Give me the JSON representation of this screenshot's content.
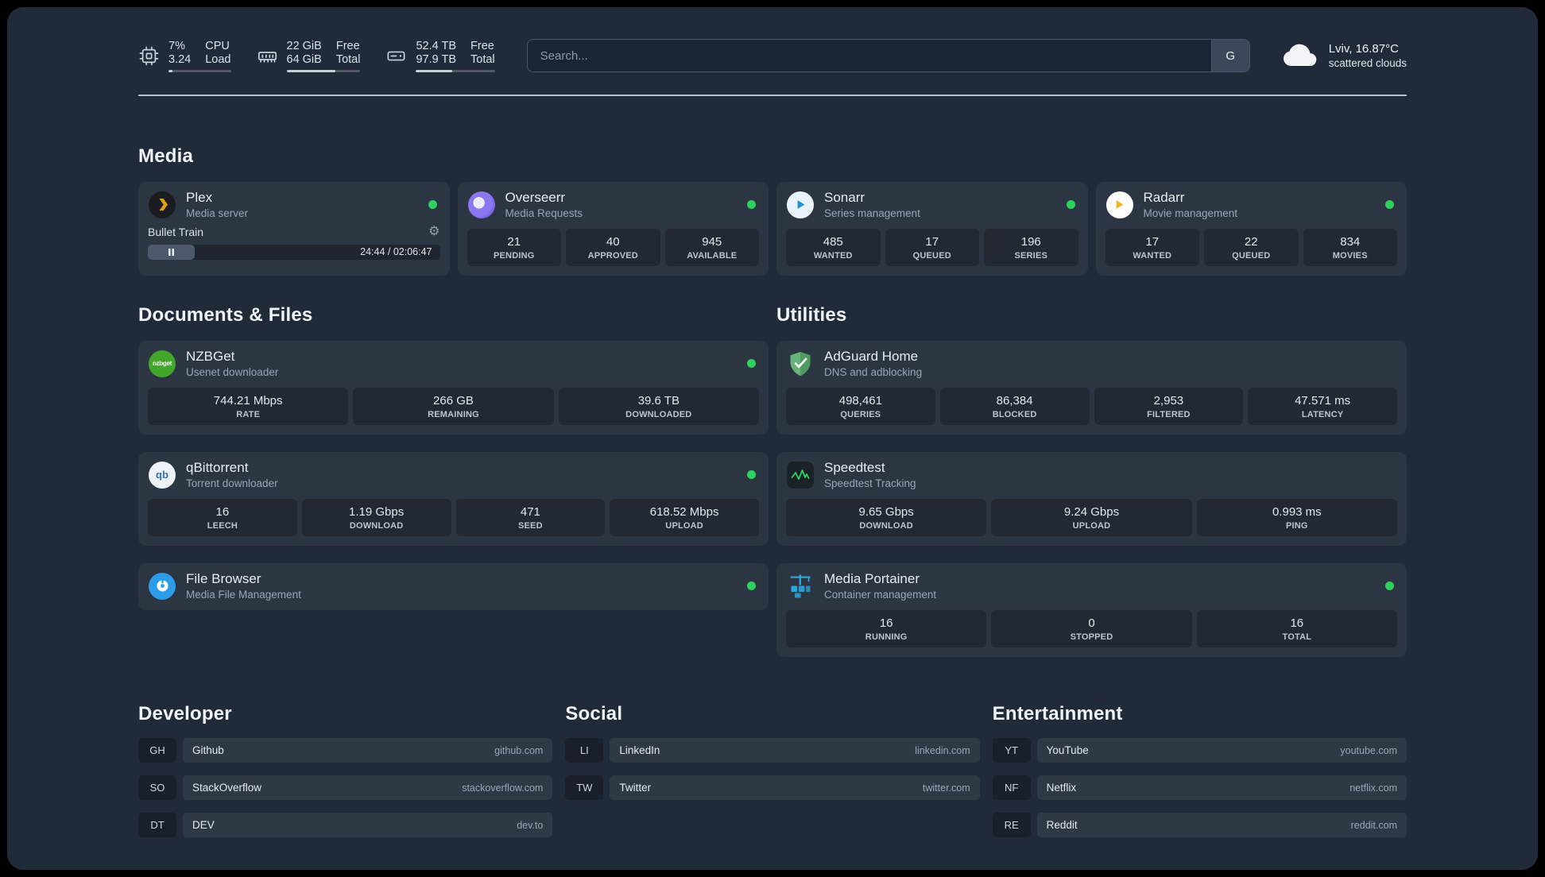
{
  "colors": {
    "status_green": "#2fd05e"
  },
  "topbar": {
    "resources": [
      {
        "id": "cpu",
        "icon": "cpu-icon",
        "values": [
          "7%",
          "3.24"
        ],
        "labels": [
          "CPU",
          "Load"
        ],
        "progress": 7
      },
      {
        "id": "memory",
        "icon": "memory-icon",
        "values": [
          "22 GiB",
          "64 GiB"
        ],
        "labels": [
          "Free",
          "Total"
        ],
        "progress": 66
      },
      {
        "id": "disk",
        "icon": "disk-icon",
        "values": [
          "52.4 TB",
          "97.9 TB"
        ],
        "labels": [
          "Free",
          "Total"
        ],
        "progress": 46
      }
    ],
    "search": {
      "placeholder": "Search...",
      "button": "G"
    },
    "weather": {
      "icon": "cloud-icon",
      "location": "Lviv, 16.87°C",
      "condition": "scattered clouds"
    }
  },
  "service_groups": [
    {
      "title": "Media",
      "slot": "media",
      "cards": [
        {
          "id": "plex",
          "name": "Plex",
          "description": "Media server",
          "icon": "plex-icon",
          "status": true,
          "media_widget": {
            "title": "Bullet Train",
            "time": "24:44 / 02:06:47",
            "progress": 16
          }
        },
        {
          "id": "overseerr",
          "name": "Overseerr",
          "description": "Media Requests",
          "icon": "overseerr-icon",
          "status": true,
          "stats": [
            {
              "value": "21",
              "label": "PENDING"
            },
            {
              "value": "40",
              "label": "APPROVED"
            },
            {
              "value": "945",
              "label": "AVAILABLE"
            }
          ]
        },
        {
          "id": "sonarr",
          "name": "Sonarr",
          "description": "Series management",
          "icon": "sonarr-icon",
          "status": true,
          "stats": [
            {
              "value": "485",
              "label": "WANTED"
            },
            {
              "value": "17",
              "label": "QUEUED"
            },
            {
              "value": "196",
              "label": "SERIES"
            }
          ]
        },
        {
          "id": "radarr",
          "name": "Radarr",
          "description": "Movie management",
          "icon": "radarr-icon",
          "status": true,
          "stats": [
            {
              "value": "17",
              "label": "WANTED"
            },
            {
              "value": "22",
              "label": "QUEUED"
            },
            {
              "value": "834",
              "label": "MOVIES"
            }
          ]
        }
      ]
    },
    {
      "title": "Documents & Files",
      "slot": "left",
      "cards": [
        {
          "id": "nzbget",
          "name": "NZBGet",
          "description": "Usenet downloader",
          "icon": "nzbget-icon",
          "status": true,
          "stats": [
            {
              "value": "744.21 Mbps",
              "label": "RATE"
            },
            {
              "value": "266 GB",
              "label": "REMAINING"
            },
            {
              "value": "39.6 TB",
              "label": "DOWNLOADED"
            }
          ]
        },
        {
          "id": "qbittorrent",
          "name": "qBittorrent",
          "description": "Torrent downloader",
          "icon": "qbittorrent-icon",
          "status": true,
          "stats": [
            {
              "value": "16",
              "label": "LEECH"
            },
            {
              "value": "1.19 Gbps",
              "label": "DOWNLOAD"
            },
            {
              "value": "471",
              "label": "SEED"
            },
            {
              "value": "618.52 Mbps",
              "label": "UPLOAD"
            }
          ]
        },
        {
          "id": "filebrowser",
          "name": "File Browser",
          "description": "Media File Management",
          "icon": "filebrowser-icon",
          "status": true,
          "stats": []
        }
      ]
    },
    {
      "title": "Utilities",
      "slot": "right",
      "cards": [
        {
          "id": "adguard",
          "name": "AdGuard Home",
          "description": "DNS and adblocking",
          "icon": "adguard-icon",
          "status": false,
          "stats": [
            {
              "value": "498,461",
              "label": "QUERIES"
            },
            {
              "value": "86,384",
              "label": "BLOCKED"
            },
            {
              "value": "2,953",
              "label": "FILTERED"
            },
            {
              "value": "47.571 ms",
              "label": "LATENCY"
            }
          ]
        },
        {
          "id": "speedtest",
          "name": "Speedtest",
          "description": "Speedtest Tracking",
          "icon": "speedtest-icon",
          "status": false,
          "stats": [
            {
              "value": "9.65 Gbps",
              "label": "DOWNLOAD"
            },
            {
              "value": "9.24 Gbps",
              "label": "UPLOAD"
            },
            {
              "value": "0.993 ms",
              "label": "PING"
            }
          ]
        },
        {
          "id": "portainer",
          "name": "Media Portainer",
          "description": "Container management",
          "icon": "portainer-icon",
          "status": true,
          "stats": [
            {
              "value": "16",
              "label": "RUNNING"
            },
            {
              "value": "0",
              "label": "STOPPED"
            },
            {
              "value": "16",
              "label": "TOTAL"
            }
          ]
        }
      ]
    }
  ],
  "bookmark_groups": [
    {
      "title": "Developer",
      "links": [
        {
          "abbr": "GH",
          "name": "Github",
          "url": "github.com"
        },
        {
          "abbr": "SO",
          "name": "StackOverflow",
          "url": "stackoverflow.com"
        },
        {
          "abbr": "DT",
          "name": "DEV",
          "url": "dev.to"
        }
      ]
    },
    {
      "title": "Social",
      "links": [
        {
          "abbr": "LI",
          "name": "LinkedIn",
          "url": "linkedin.com"
        },
        {
          "abbr": "TW",
          "name": "Twitter",
          "url": "twitter.com"
        }
      ]
    },
    {
      "title": "Entertainment",
      "links": [
        {
          "abbr": "YT",
          "name": "YouTube",
          "url": "youtube.com"
        },
        {
          "abbr": "NF",
          "name": "Netflix",
          "url": "netflix.com"
        },
        {
          "abbr": "RE",
          "name": "Reddit",
          "url": "reddit.com"
        }
      ]
    }
  ]
}
